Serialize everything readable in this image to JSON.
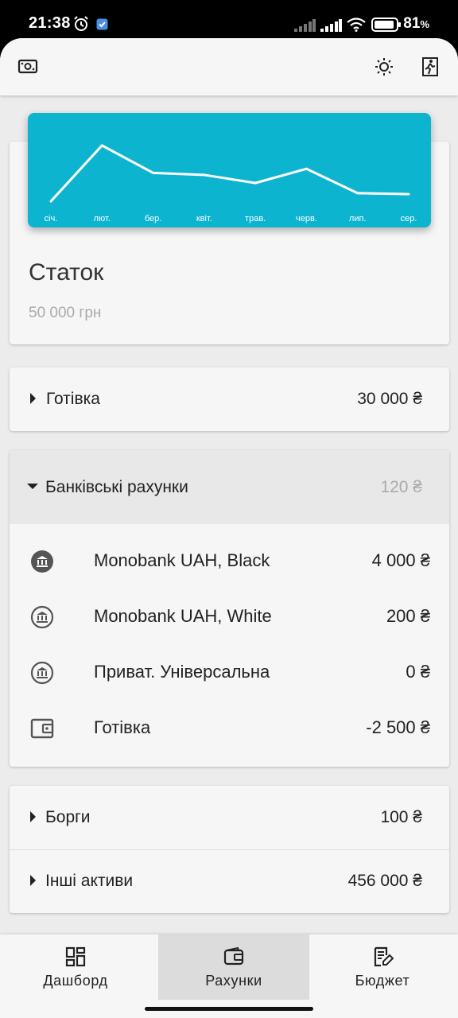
{
  "status_bar": {
    "time": "21:38",
    "battery": "81"
  },
  "appbar": {
    "left_icon": "money-icon",
    "theme_icon": "brightness-icon",
    "exit_icon": "exit-icon"
  },
  "balance_card": {
    "title": "Статок",
    "value": "50 000 грн",
    "chart_data": {
      "type": "line",
      "categories": [
        "січ.",
        "лют.",
        "бер.",
        "квіт.",
        "трав.",
        "черв.",
        "лип.",
        "сер."
      ],
      "series": [
        {
          "values": [
            7,
            62,
            35,
            33,
            25,
            39,
            15,
            14
          ]
        }
      ],
      "ylim": [
        0,
        80
      ],
      "grid": false,
      "line_color": "#ffffff",
      "background": "#0cb4d0"
    }
  },
  "cash_group": {
    "label": "Готівка",
    "amount": "30 000 ₴"
  },
  "bank_group": {
    "label": "Банківські рахунки",
    "amount": "120 ₴",
    "accounts": [
      {
        "name": "Monobank UAH, Black",
        "amount": "4 000 ₴",
        "icon": "bank-filled-icon"
      },
      {
        "name": "Monobank UAH, White",
        "amount": "200 ₴",
        "icon": "bank-outline-icon"
      },
      {
        "name": "Приват. Універсальна",
        "amount": "0 ₴",
        "icon": "bank-outline-icon"
      },
      {
        "name": "Готівка",
        "amount": "-2 500 ₴",
        "icon": "wallet-icon"
      }
    ]
  },
  "debts_group": {
    "label": "Борги",
    "amount": "100 ₴"
  },
  "other_group": {
    "label": "Інші активи",
    "amount": "456 000 ₴"
  },
  "bottom_nav": [
    {
      "label": "Дашборд",
      "icon": "dashboard-icon",
      "active": false
    },
    {
      "label": "Рахунки",
      "icon": "wallet-icon",
      "active": true
    },
    {
      "label": "Бюджет",
      "icon": "budget-icon",
      "active": false
    }
  ],
  "colors": {
    "accent": "#0cb4d0",
    "background": "#ececec",
    "card": "#f6f6f6",
    "active_nav": "#dcdcdc"
  }
}
